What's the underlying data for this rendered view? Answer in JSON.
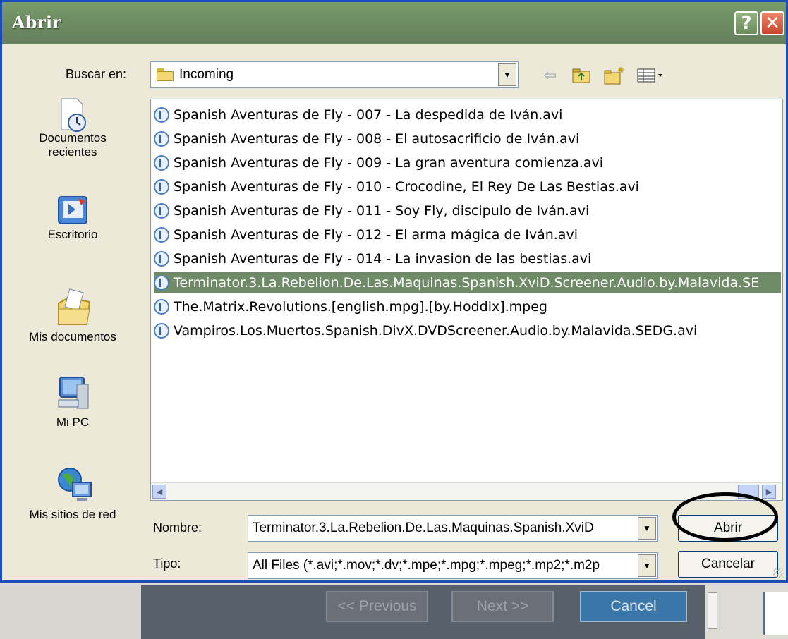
{
  "dialog": {
    "title": "Abrir",
    "help_glyph": "?",
    "close_glyph": "✕"
  },
  "look_in": {
    "label": "Buscar en:",
    "value": "Incoming"
  },
  "places": [
    {
      "label_line1": "Documentos",
      "label_line2": "recientes",
      "icon": "recent-documents-icon"
    },
    {
      "label_line1": "Escritorio",
      "label_line2": "",
      "icon": "desktop-icon"
    },
    {
      "label_line1": "Mis documentos",
      "label_line2": "",
      "icon": "my-documents-icon"
    },
    {
      "label_line1": "Mi PC",
      "label_line2": "",
      "icon": "my-computer-icon"
    },
    {
      "label_line1": "Mis sitios de red",
      "label_line2": "",
      "icon": "network-places-icon"
    }
  ],
  "files": [
    {
      "name": "Spanish Aventuras de Fly - 007 - La despedida de Iván.avi",
      "selected": false
    },
    {
      "name": "Spanish Aventuras de Fly - 008 - El autosacrificio de Iván.avi",
      "selected": false
    },
    {
      "name": "Spanish Aventuras de Fly - 009 - La gran aventura comienza.avi",
      "selected": false
    },
    {
      "name": "Spanish Aventuras de Fly - 010 - Crocodine, El Rey De Las Bestias.avi",
      "selected": false
    },
    {
      "name": "Spanish Aventuras de Fly - 011 - Soy Fly, discipulo de Iván.avi",
      "selected": false
    },
    {
      "name": "Spanish Aventuras de Fly - 012 - El arma mágica de Iván.avi",
      "selected": false
    },
    {
      "name": "Spanish Aventuras de Fly - 014 - La invasion de las bestias.avi",
      "selected": false
    },
    {
      "name": "Terminator.3.La.Rebelion.De.Las.Maquinas.Spanish.XviD.Screener.Audio.by.Malavida.SE",
      "selected": true
    },
    {
      "name": "The.Matrix.Revolutions.[english.mpg].[by.Hoddix].mpeg",
      "selected": false
    },
    {
      "name": "Vampiros.Los.Muertos.Spanish.DivX.DVDScreener.Audio.by.Malavida.SEDG.avi",
      "selected": false
    }
  ],
  "filename": {
    "label": "Nombre:",
    "value": "Terminator.3.La.Rebelion.De.Las.Maquinas.Spanish.XviD"
  },
  "filetype": {
    "label": "Tipo:",
    "value": "All Files (*.avi;*.mov;*.dv;*.mpe;*.mpg;*.mpeg;*.mp2;*.m2p"
  },
  "buttons": {
    "open": "Abrir",
    "cancel": "Cancelar"
  },
  "background_app": {
    "previous": "<< Previous",
    "next": "Next >>",
    "cancel": "Cancel"
  }
}
